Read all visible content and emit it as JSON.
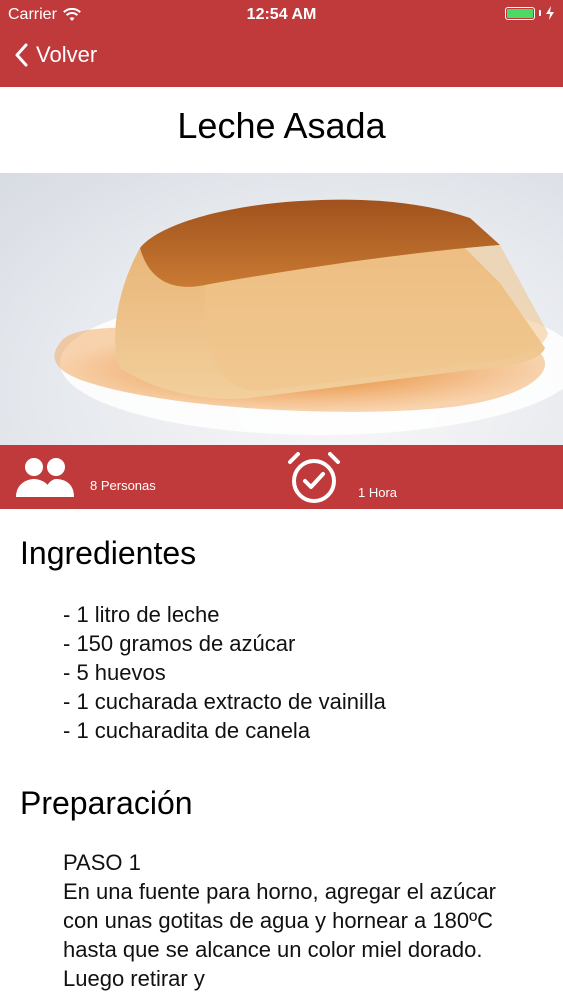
{
  "status": {
    "carrier": "Carrier",
    "time": "12:54 AM"
  },
  "nav": {
    "back_label": "Volver"
  },
  "recipe": {
    "title": "Leche Asada",
    "servings": "8 Personas",
    "duration": "1 Hora"
  },
  "ingredients": {
    "heading": "Ingredientes",
    "items": [
      "- 1 litro de leche",
      "- 150 gramos de azúcar",
      "- 5 huevos",
      "- 1 cucharada extracto de vainilla",
      "- 1 cucharadita de canela"
    ]
  },
  "preparation": {
    "heading": "Preparación",
    "step_label": "PASO 1",
    "step_text": "En una fuente para horno, agregar el azúcar con unas gotitas de agua y hornear a 180ºC hasta que se alcance un color miel dorado. Luego retirar y"
  },
  "colors": {
    "brand_red": "#c0393b",
    "battery_green": "#4cd964"
  }
}
